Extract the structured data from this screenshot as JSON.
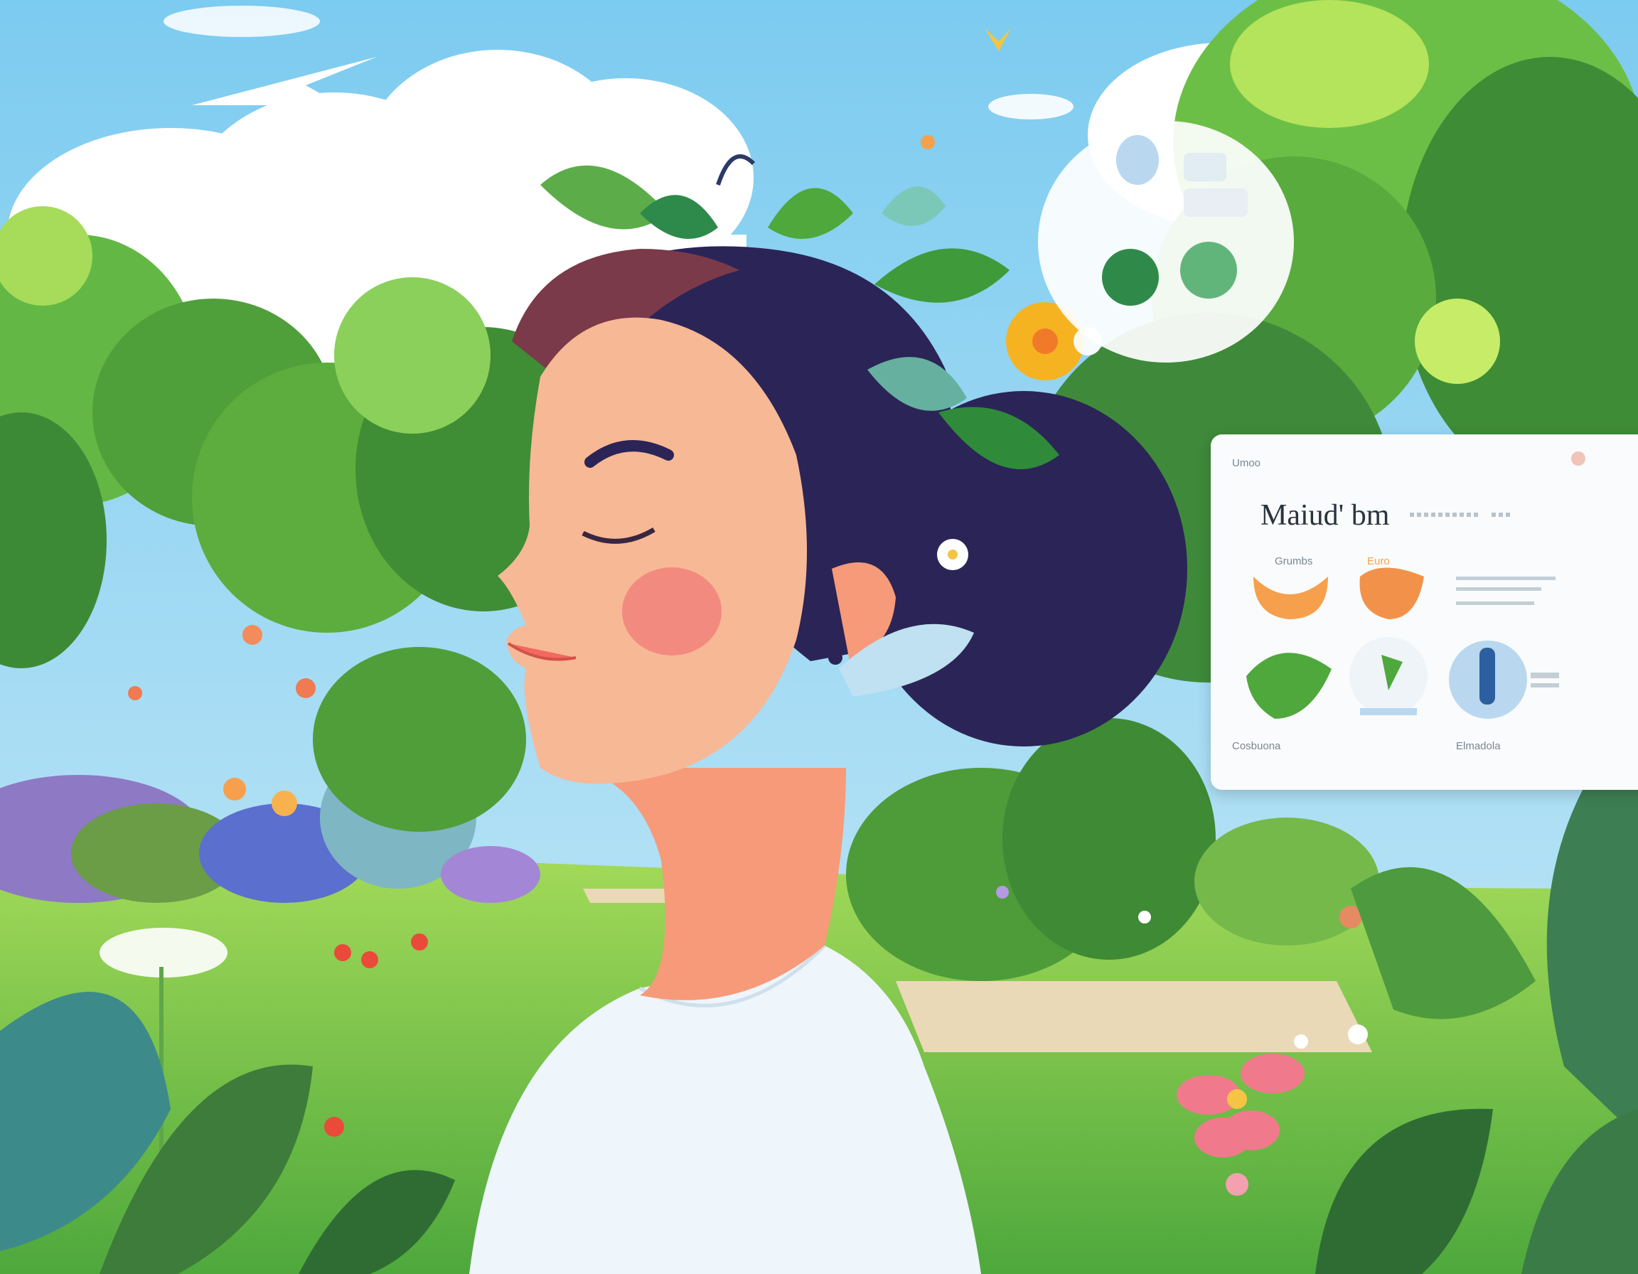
{
  "illustration": {
    "subject": "woman with closed eyes in a garden",
    "icons": [
      "sparkle-icon",
      "leaf-icon",
      "flower-icon",
      "bird-icon"
    ]
  },
  "panel": {
    "header_label": "Umoo",
    "title": "Maiud' bm",
    "card1_label": "Grumbs",
    "card2_label": "Euro",
    "footer_left": "Cosbuona",
    "footer_right": "Elmadola"
  },
  "colors": {
    "sky": "#8fd3f0",
    "grass": "#6fc24a",
    "hair": "#2b2456",
    "skin": "#f7b896",
    "shirt": "#eef5fb",
    "accent_orange": "#f6a04d"
  }
}
